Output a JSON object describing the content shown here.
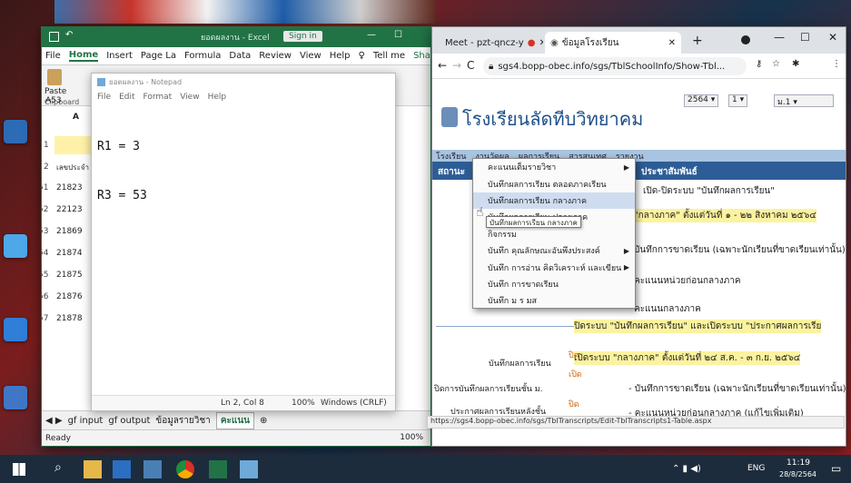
{
  "excel": {
    "title": "ยอดผลงาน - Excel",
    "signin": "Sign in",
    "menu": [
      "File",
      "Home",
      "Insert",
      "Page La",
      "Formula",
      "Data",
      "Review",
      "View",
      "Help",
      "Tell me",
      "Shar"
    ],
    "ribbon": {
      "paste": "Paste",
      "clipboard": "Clipboard"
    },
    "cell_ref": "A53",
    "col_a": "A",
    "header_cell": "เลขประจำ",
    "rows": [
      {
        "n": "1",
        "v": ""
      },
      {
        "n": "2",
        "v": "เลขประจำ"
      },
      {
        "n": "51",
        "v": "21823"
      },
      {
        "n": "52",
        "v": "22123"
      },
      {
        "n": "53",
        "v": "21869"
      },
      {
        "n": "54",
        "v": "21874"
      },
      {
        "n": "55",
        "v": "21875"
      },
      {
        "n": "56",
        "v": "21876"
      },
      {
        "n": "57",
        "v": "21878"
      }
    ],
    "sheet_tabs": [
      "gf input",
      "gf output",
      "ข้อมูลรายวิชา",
      "คะแนน"
    ],
    "status": {
      "ready": "Ready",
      "zoom": "100%"
    }
  },
  "notepad": {
    "title": "ยอดผลงาน - Notepad",
    "menu": [
      "File",
      "Edit",
      "Format",
      "View",
      "Help"
    ],
    "lines": [
      "R1 = 3",
      "R3 = 53"
    ],
    "status": {
      "pos": "Ln 2, Col 8",
      "zoom": "100%",
      "eol": "Windows (CRLF)"
    }
  },
  "chrome": {
    "tabs": [
      "Meet - pzt-qncz-y",
      "ข้อมูลโรงเรียน"
    ],
    "url": "sgs4.bopp-obec.info/sgs/TblSchoolInfo/Show-Tbl...",
    "school_name": "โรงเรียนลัดทีบวิทยาคม",
    "year": "2564",
    "term": "1",
    "level": "ม.1",
    "nav": [
      "โรงเรียน",
      "งานวัดผล",
      "ผลการเรียน",
      "สารสนเทศ",
      "รายงาน"
    ],
    "table_header_left": "สถานะ",
    "table_header_right": "ประชาสัมพันธ์",
    "content_lines": [
      "เปิด-ปิดระบบ \"บันทึกผลการเรียน\"",
      "\"กลางภาค\" ตั้งแต่วันที่ ๑ - ๒๒ สิงหาคม ๒๕๖๔",
      "บันทึกการขาดเรียน (เฉพาะนักเรียนที่ขาดเรียนเท่านั้น)",
      "คะแนนหน่วยก่อนกลางภาค",
      "คะแนนกลางภาค"
    ],
    "announce_1": "ปิดระบบ \"บันทึกผลการเรียน\" และเปิดระบบ \"ประกาศผลการเรีย",
    "announce_2": "เปิดระบบ \"กลางภาค\" ตั้งแต่วันที่ ๒๔ ส.ค. - ๓ ก.ย. ๒๕๖๔",
    "status_rows": [
      {
        "label": "บันทึกผลการเรียน",
        "status": "ปิด"
      },
      {
        "label": "",
        "status": "เปิด"
      },
      {
        "label": "ปิดการบันทึกผลการเรียนชั้น ม.",
        "status": ""
      },
      {
        "label": "ประกาศผลการเรียนหลังชั้น",
        "status": "ปิด"
      }
    ],
    "bottom_lines": [
      "- บันทึกการขาดเรียน (เฉพาะนักเรียนที่ขาดเรียนเท่านั้น)",
      "- คะแนนหน่วยก่อนกลางภาค (แก้ไขเพิ่มเติม)"
    ],
    "dropdown": [
      {
        "label": "คะแนนเต็มรายวิชา",
        "sub": true
      },
      {
        "label": "บันทึกผลการเรียน ตลอดภาคเรียน",
        "sub": false
      },
      {
        "label": "บันทึกผลการเรียน กลางภาค",
        "sub": false
      },
      {
        "label": "บันทึกผลการเรียน ปลายภาค",
        "sub": false
      },
      {
        "label": "กิจกรรม",
        "sub": false
      },
      {
        "label": "บันทึก คุณลักษณะอันพึงประสงค์",
        "sub": true
      },
      {
        "label": "บันทึก การอ่าน คิดวิเคราะห์ และเขียน",
        "sub": true
      },
      {
        "label": "บันทึก การขาดเรียน",
        "sub": false
      },
      {
        "label": "บันทึก ม ร มส",
        "sub": false
      }
    ],
    "tooltip": "บันทึกผลการเรียน กลางภาค",
    "status_url": "https://sgs4.bopp-obec.info/sgs/TblTranscripts/Edit-TblTranscripts1-Table.aspx"
  },
  "taskbar": {
    "lang": "ENG",
    "time": "11:19",
    "date": "28/8/2564"
  }
}
